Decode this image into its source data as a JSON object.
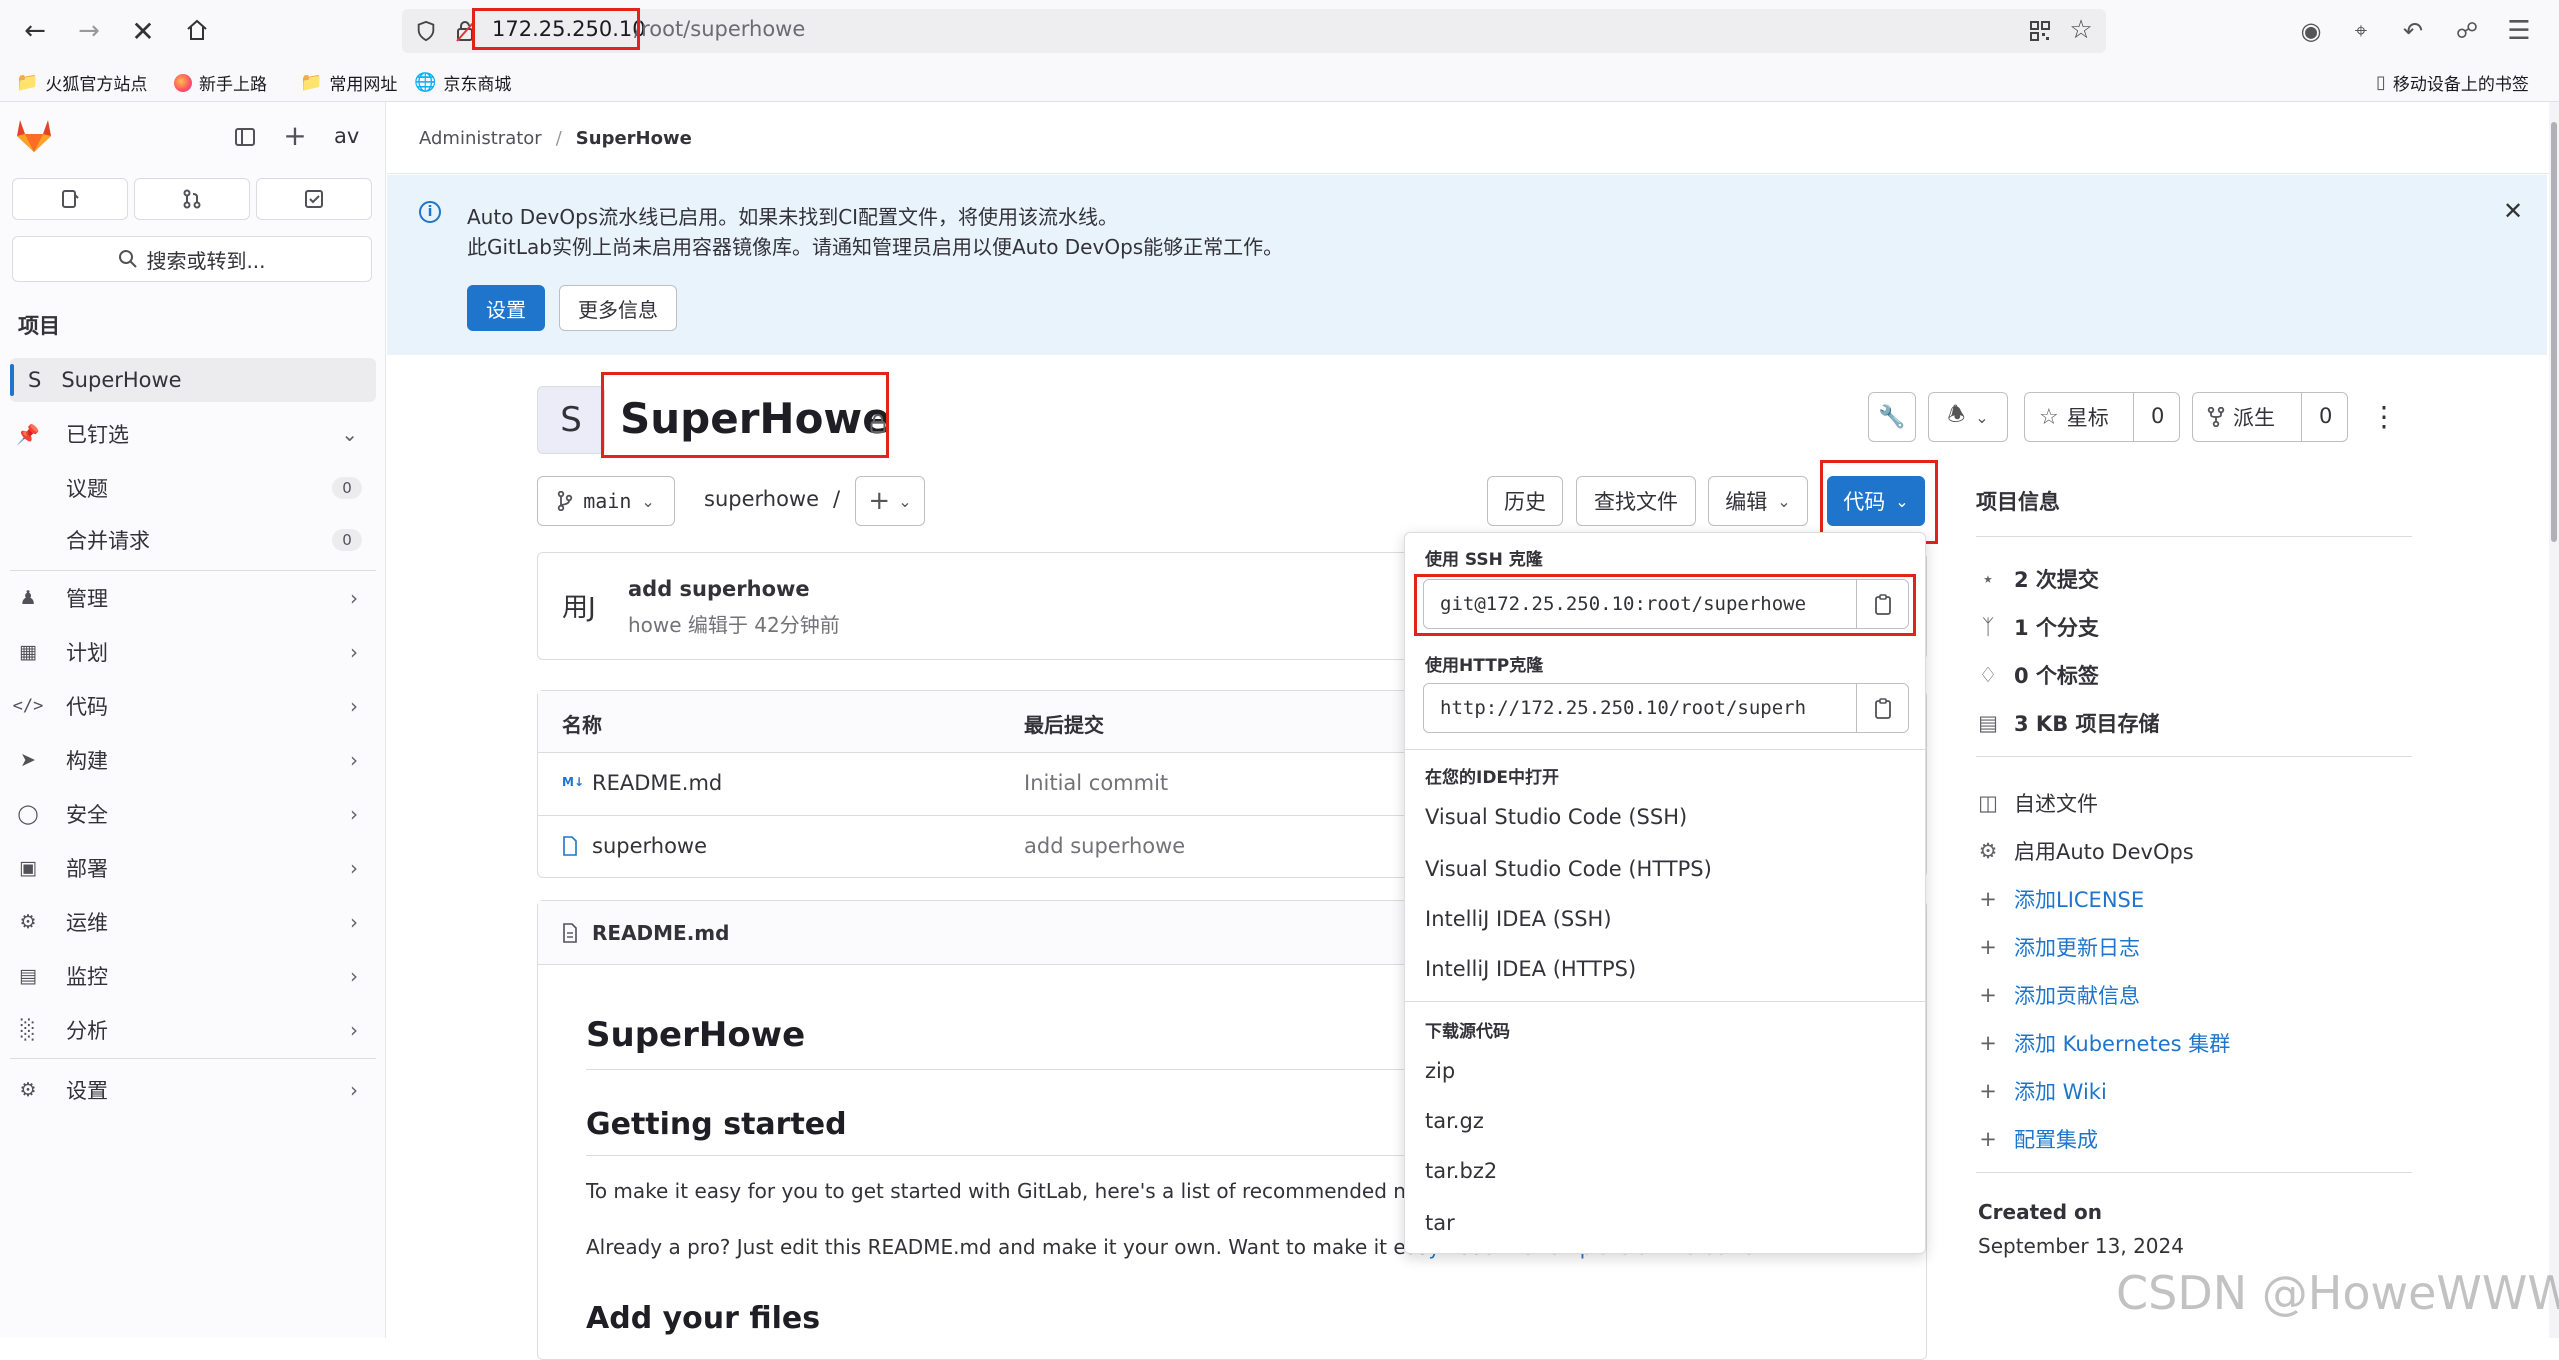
{
  "browser": {
    "url_host": "172.25.250.10",
    "url_path": "/root/superhowe",
    "bookmarks": [
      "火狐官方站点",
      "新手上路",
      "常用网址",
      "京东商城"
    ],
    "mobile_bookmarks": "移动设备上的书签"
  },
  "sidebar": {
    "user_short": "av",
    "search_placeholder": "搜索或转到...",
    "section_title": "项目",
    "project_letter": "S",
    "project_name": "SuperHowe",
    "pinned_label": "已钉选",
    "pinned_items": [
      {
        "label": "议题",
        "count": "0"
      },
      {
        "label": "合并请求",
        "count": "0"
      }
    ],
    "groups": [
      "管理",
      "计划",
      "代码",
      "构建",
      "安全",
      "部署",
      "运维",
      "监控",
      "分析"
    ],
    "settings": "设置"
  },
  "breadcrumb": {
    "parent": "Administrator",
    "separator": "/",
    "current": "SuperHowe"
  },
  "banner": {
    "line1": "Auto DevOps流水线已启用。如果未找到CI配置文件，将使用该流水线。",
    "line2": "此GitLab实例上尚未启用容器镜像库。请通知管理员启用以便Auto DevOps能够正常工作。",
    "primary_button": "设置",
    "secondary_button": "更多信息"
  },
  "project": {
    "avatar_letter": "S",
    "title": "SuperHowe",
    "star_label": "星标",
    "star_count": "0",
    "fork_label": "派生",
    "fork_count": "0"
  },
  "repo_toolbar": {
    "branch": "main",
    "path": "superhowe",
    "path_sep": "/",
    "history": "历史",
    "find_file": "查找文件",
    "edit": "编辑",
    "code": "代码"
  },
  "last_commit": {
    "avatar_text": "用J",
    "message": "add superhowe",
    "meta": "howe 编辑于 42分钟前"
  },
  "file_table": {
    "headers": [
      "名称",
      "最后提交"
    ],
    "rows": [
      {
        "name": "README.md",
        "commit": "Initial commit",
        "icon": "markdown-icon"
      },
      {
        "name": "superhowe",
        "commit": "add superhowe",
        "icon": "file-icon"
      }
    ]
  },
  "readme": {
    "filename": "README.md",
    "h1": "SuperHowe",
    "h2_getting_started": "Getting started",
    "p1": "To make it easy for you to get started with GitLab, here's a list of recommended ne",
    "p2_start": "Already a pro? Just edit this README.md and make it your own. Want to make it eas",
    "p2_link": "y? Use the template at the bottom!",
    "h2_add_files": "Add your files"
  },
  "code_dropdown": {
    "ssh_title": "使用 SSH 克隆",
    "ssh_url": "git@172.25.250.10:root/superhowe",
    "http_title": "使用HTTP克隆",
    "http_url": "http://172.25.250.10/root/superh",
    "ide_title": "在您的IDE中打开",
    "ide_items": [
      "Visual Studio Code (SSH)",
      "Visual Studio Code (HTTPS)",
      "IntelliJ IDEA (SSH)",
      "IntelliJ IDEA (HTTPS)"
    ],
    "download_title": "下载源代码",
    "download_items": [
      "zip",
      "tar.gz",
      "tar.bz2",
      "tar"
    ]
  },
  "project_info": {
    "title": "项目信息",
    "stats": [
      "2 次提交",
      "1 个分支",
      "0 个标签",
      "3 KB 项目存储"
    ],
    "readme": "自述文件",
    "devops": "启用Auto DevOps",
    "add_links": [
      "添加LICENSE",
      "添加更新日志",
      "添加贡献信息",
      "添加 Kubernetes 集群",
      "添加 Wiki",
      "配置集成"
    ],
    "created_label": "Created on",
    "created_date": "September 13, 2024"
  },
  "watermark": "CSDN @HoweWWW"
}
